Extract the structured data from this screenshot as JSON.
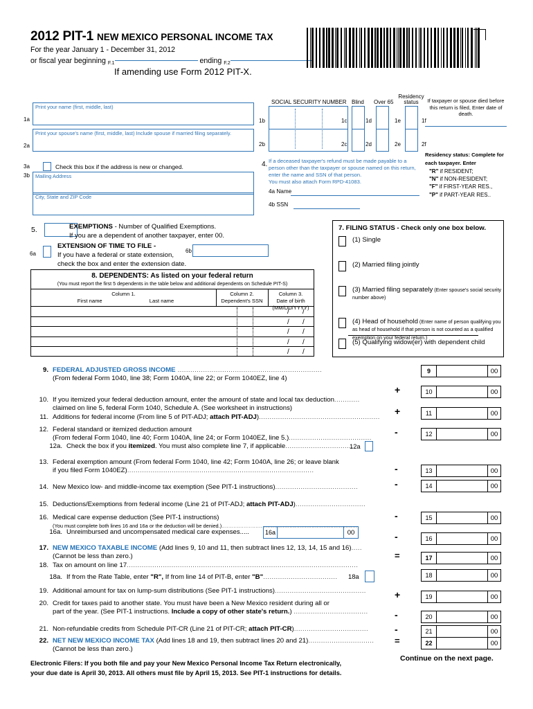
{
  "header": {
    "title_year_form": "2012 PIT-1",
    "title_rest": "NEW MEXICO PERSONAL INCOME TAX",
    "year_line": "For the year January 1 -  December 31, 2012",
    "fiscal_prefix": "or fiscal year beginning",
    "fiscal_f1": "F.1",
    "fiscal_ending": "ending",
    "fiscal_f2": "F.2",
    "amend_note": "If amending use Form 2012 PIT-X.",
    "barcode_name": "form-barcode"
  },
  "personal": {
    "name_label": "Print your name (first, middle, last)",
    "name_num": "1a",
    "spouse_label": "Print your spouse's name (first, middle, last) Include spouse if married filing separately.",
    "spouse_num": "2a",
    "addr_change_num": "3a",
    "addr_change_text": "Check this box if the address is new or changed.",
    "mailing_num": "3b",
    "mailing_label": "Mailing Address",
    "city_label": "City, State and ZIP Code"
  },
  "ssn": {
    "label": "SOCIAL SECURITY NUMBER",
    "num1": "1b",
    "num2": "2b",
    "blind_label": "Blind",
    "blind_num1": "1c",
    "blind_num2": "2c",
    "over65_label": "Over 65",
    "over65_num1": "1d",
    "over65_num2": "2d",
    "residency_label": "Residency status",
    "res_num1": "1e",
    "res_num2": "2e",
    "death_num1": "1f",
    "death_num2": "2f"
  },
  "death": {
    "note": "If taxpayer or spouse died before this return is filed, Enter date of death."
  },
  "block4": {
    "num": "4.",
    "text": "If a deceased taxpayer's refund must be made payable to a person other than the taxpayer or spouse named on this return, enter the name and SSN of that person.",
    "text2": "You must also attach Form RPD-41083.",
    "name_label": "4a Name",
    "ssn_label": "4b SSN"
  },
  "residency_instructions": {
    "heading": "Residency status: Complete for each taxpayer. Enter",
    "items": [
      {
        "code": "\"R\"",
        "text": " if RESIDENT;"
      },
      {
        "code": "\"N\"",
        "text": " if NON-RESIDENT;"
      },
      {
        "code": "\"F\"",
        "text": " if FIRST-YEAR RES.,"
      },
      {
        "code": "\"P\"",
        "text": " if  PART-YEAR RES.."
      }
    ]
  },
  "exemptions": {
    "num": "5.",
    "title": "EXEMPTIONS",
    "line1_rest": " - Number of Qualified Exemptions.",
    "line2": "If you are a dependent of another taxpayer, enter 00."
  },
  "extension": {
    "num_a": "6a",
    "num_b": "6b",
    "title": "EXTENSION OF TIME TO FILE -",
    "line2": "If you have a federal or state extension,",
    "line3": "check the box and enter the extension date."
  },
  "filing_status": {
    "heading": "7.   FILING STATUS -  Check only one box below.",
    "options": [
      {
        "label": "(1)  Single",
        "note": ""
      },
      {
        "label": "(2)  Married filing jointly",
        "note": ""
      },
      {
        "label": "(3)  Married filing separately",
        "note": " (Enter spouse's social security number above)"
      },
      {
        "label": "(4)  Head of household",
        "note": " (Enter name of person qualifying you as head of household if that person is not counted as a qualified exemption on your federal return.)"
      },
      {
        "label": "(5)  Qualifying widow(er) with dependent child",
        "note": ""
      }
    ]
  },
  "dependents": {
    "heading": "8.   DEPENDENTS: As listed on your federal return",
    "subheading": "(You must report the first 5 dependents in the table below and additional dependents on Schedule PIT-S)",
    "col1_top": "Column 1.",
    "col1_first": "First name",
    "col1_last": "Last name",
    "col2_top": "Column 2.",
    "col2_sub": "Dependent's SSN",
    "col3_top": "Column 3.",
    "col3_sub": "Date of birth (MM/DD/YYYY)",
    "row_count": 5,
    "rows": [
      {
        "first": "",
        "last": "",
        "ssn": "",
        "dob": ""
      },
      {
        "first": "",
        "last": "",
        "ssn": "",
        "dob": ""
      },
      {
        "first": "",
        "last": "",
        "ssn": "",
        "dob": ""
      },
      {
        "first": "",
        "last": "",
        "ssn": "",
        "dob": ""
      },
      {
        "first": "",
        "last": "",
        "ssn": "",
        "dob": ""
      }
    ]
  },
  "lines": {
    "l9_num": "9.",
    "l9_title": "FEDERAL ADJUSTED GROSS INCOME",
    "l9_sub": "(From federal Form 1040, line 38; Form 1040A, line 22; or Form 1040EZ, line 4)",
    "l10_num": "10.",
    "l10_a": "If you itemized your federal deduction amount, enter the amount of state and local tax deduction",
    "l10_b": "claimed on line 5, federal Form 1040, Schedule A. (See worksheet in instructions)",
    "l11_num": "11.",
    "l11_a": "Additions for federal income (From line 5 of PIT-ADJ; ",
    "l11_bold": "attach PIT-ADJ",
    "l11_c": ")",
    "l12_num": "12.",
    "l12_a": "Federal standard or itemized deduction amount",
    "l12_b": "(From federal Form 1040, line 40; Form 1040A, line 24; or Form 1040EZ, line 5.)",
    "l12a_num": "12a.",
    "l12a_a": "Check the box if you ",
    "l12a_bold": "itemized",
    "l12a_c": ". You must also complete line 7, if applicable",
    "l12a_tag": "12a",
    "l13_num": "13.",
    "l13_a": "Federal exemption amount (From federal Form 1040, line 42; Form 1040A, line 26; or leave blank",
    "l13_b": "if you filed Form 1040EZ)",
    "l14_num": "14.",
    "l14_a": "New Mexico low- and middle-income tax exemption (See PIT-1 instructions)",
    "l15_num": "15.",
    "l15_a": "Deductions/Exemptions from federal income (Line 21 of PIT-ADJ; ",
    "l15_bold": "attach PIT-ADJ",
    "l15_c": ")",
    "l16_num": "16.",
    "l16_a": "Medical care expense deduction (See PIT-1 instructions)",
    "l16_b": "(You must complete both lines 16 and 16a or the deduction will be denied.)",
    "l16a_num": "16a.",
    "l16a_a": "Unreimbursed and uncompensated medical care expenses.....",
    "l16a_tag": "16a",
    "l16a_cents": "00",
    "l17_num": "17.",
    "l17_title": "NEW MEXICO TAXABLE INCOME",
    "l17_rest": " (Add lines 9, 10 and 11, then subtract lines 12, 13, 14, 15 and 16)",
    "l17_b": "(Cannot be less than zero.)",
    "l18_num": "18.",
    "l18_a": "Tax on amount on line 17",
    "l18a_num": "18a.",
    "l18a_a": "If from the Rate Table, enter ",
    "l18a_r": "\"R\",",
    "l18a_b": "     If from line 14 of PIT-B, enter ",
    "l18a_bb": "\"B\"",
    "l18a_tag": "18a",
    "l19_num": "19.",
    "l19_a": "Additional amount for tax on lump-sum distributions (See PIT-1 instructions)",
    "l20_num": "20.",
    "l20_a": "Credit for taxes paid to another state. You must have been a New Mexico resident during all or",
    "l20_b": "part of the year. (See PIT-1 instructions. ",
    "l20_bold": "Include a copy of other state's return.",
    "l20_c": ") ",
    "l21_num": "21.",
    "l21_a": "Non-refundable credits from Schedule PIT-CR (Line 21 of PIT-CR; ",
    "l21_bold": "attach PIT-CR",
    "l21_c": ")",
    "l22_num": "22.",
    "l22_title": "NET NEW MEXICO INCOME TAX",
    "l22_rest": " (Add lines 18 and 19, then subtract lines 20 and 21)",
    "l22_b": "(Cannot be less than zero.)"
  },
  "amount_boxes": [
    {
      "line": "9",
      "op": "",
      "cents": "00",
      "value": ""
    },
    {
      "line": "10",
      "op": "+",
      "cents": "00",
      "value": ""
    },
    {
      "line": "11",
      "op": "+",
      "cents": "00",
      "value": ""
    },
    {
      "line": "12",
      "op": "-",
      "cents": "00",
      "value": ""
    },
    {
      "line": "13",
      "op": "-",
      "cents": "00",
      "value": ""
    },
    {
      "line": "14",
      "op": "-",
      "cents": "00",
      "value": ""
    },
    {
      "line": "15",
      "op": "-",
      "cents": "00",
      "value": ""
    },
    {
      "line": "16",
      "op": "-",
      "cents": "00",
      "value": ""
    },
    {
      "line": "17",
      "op": "=",
      "cents": "00",
      "value": ""
    },
    {
      "line": "18",
      "op": "",
      "cents": "00",
      "value": ""
    },
    {
      "line": "19",
      "op": "+",
      "cents": "00",
      "value": ""
    },
    {
      "line": "20",
      "op": "-",
      "cents": "00",
      "value": ""
    },
    {
      "line": "21",
      "op": "-",
      "cents": "00",
      "value": ""
    },
    {
      "line": "22",
      "op": "=",
      "cents": "00",
      "value": ""
    }
  ],
  "footer": {
    "electronic_line1": "Electronic Filers: If you both file and pay your New Mexico Personal Income Tax Return electronically,",
    "electronic_line2": "your due date is April 30, 2013. All others must file by April 15, 2013. See PIT-1 instructions for details.",
    "continue": "Continue on the next page."
  },
  "colors": {
    "form_blue": "#2e74b5",
    "heading_blue": "#1f6fb5",
    "black": "#000000"
  }
}
